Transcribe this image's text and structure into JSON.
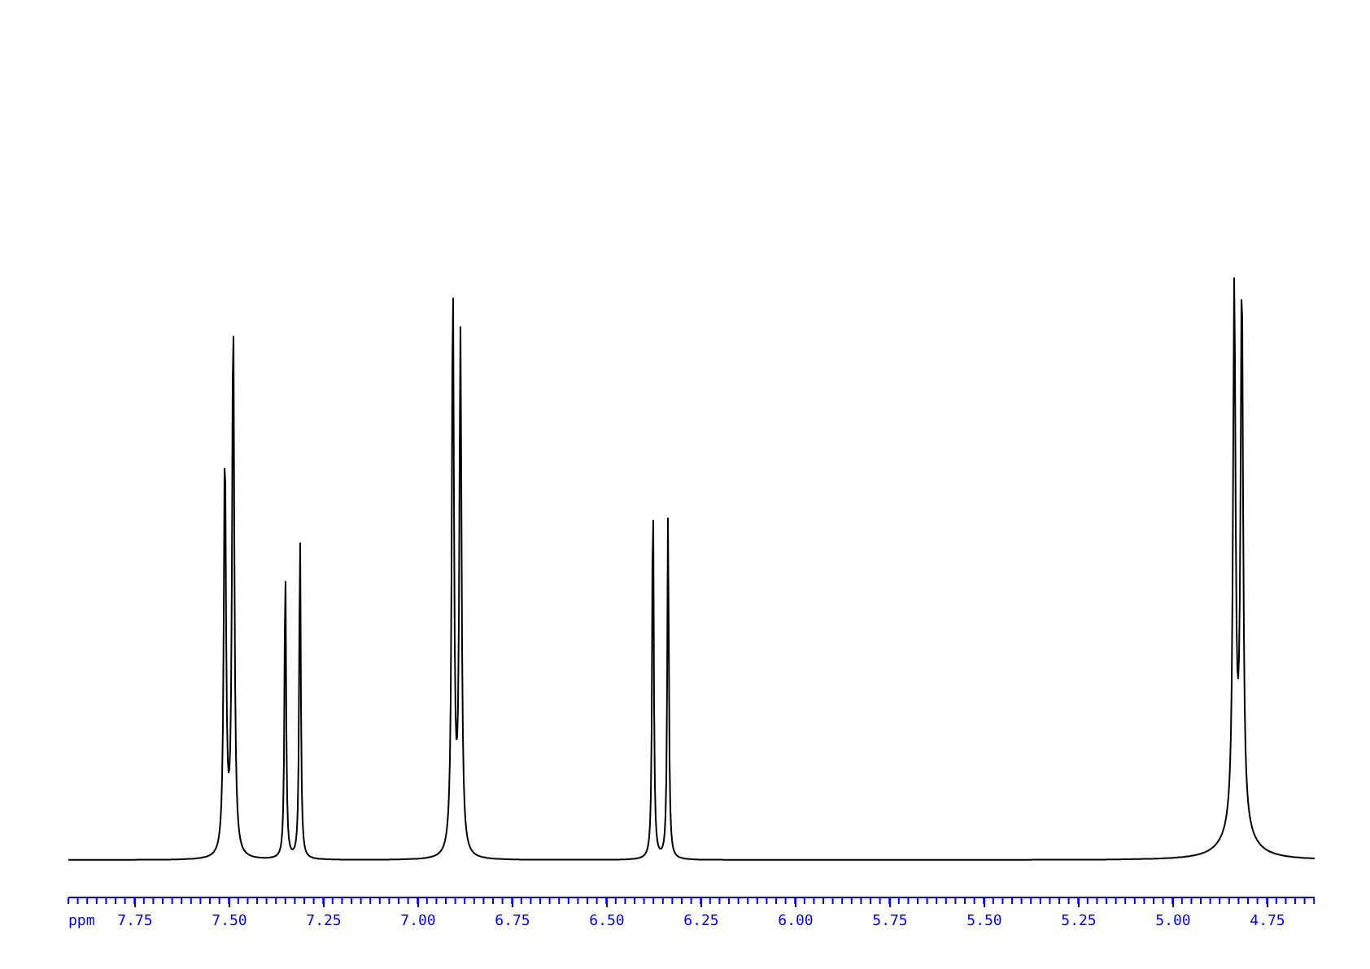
{
  "axis": {
    "unit": "ppm",
    "tick_labels": [
      "7.75",
      "7.50",
      "7.25",
      "7.00",
      "6.75",
      "6.50",
      "6.25",
      "6.00",
      "5.75",
      "5.50",
      "5.25",
      "5.00",
      "4.75"
    ]
  }
}
